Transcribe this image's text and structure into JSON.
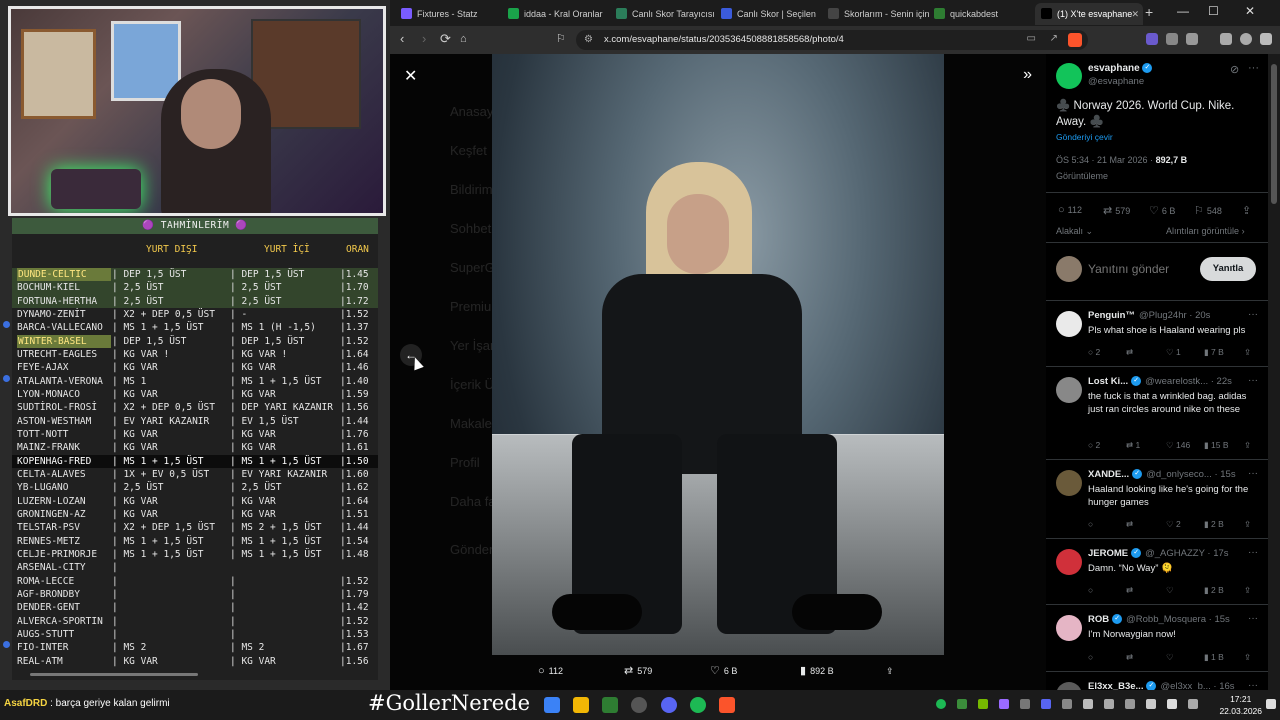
{
  "overlay": {
    "table_title": "TAHMİNLERİM",
    "headers": {
      "foreign": "YURT DIŞI",
      "domestic": "YURT İÇİ",
      "odds": "ORAN"
    },
    "rows": [
      {
        "match": "DUNDE-CELTIC",
        "foreign": "| DEP 1,5 ÜST",
        "domestic": "| DEP 1,5 ÜST",
        "odds": "|1.45",
        "style": "hl-green",
        "label_box": true,
        "dot": false
      },
      {
        "match": "BOCHUM-KIEL",
        "foreign": "| 2,5 ÜST",
        "domestic": "| 2,5 ÜST",
        "odds": "|1.70",
        "style": "hl-green",
        "label_box": false,
        "dot": false
      },
      {
        "match": "FORTUNA-HERTHA",
        "foreign": "| 2,5 ÜST",
        "domestic": "| 2,5 ÜST",
        "odds": "|1.72",
        "style": "hl-green",
        "label_box": false,
        "dot": false
      },
      {
        "match": "DYNAMO-ZENİT",
        "foreign": "| X2 + DEP 0,5 ÜST",
        "domestic": "| -",
        "odds": "|1.52",
        "style": "",
        "label_box": false,
        "dot": false
      },
      {
        "match": "BARCA-VALLECANO",
        "foreign": "| MS 1 + 1,5 ÜST",
        "domestic": "| MS 1 (H -1,5)",
        "odds": "|1.37",
        "style": "",
        "label_box": false,
        "dot": true
      },
      {
        "match": "WINTER-BASEL",
        "foreign": "| DEP 1,5 ÜST",
        "domestic": "| DEP 1,5 ÜST",
        "odds": "|1.52",
        "style": "",
        "label_box": true,
        "dot": false
      },
      {
        "match": "UTRECHT-EAGLES",
        "foreign": "| KG VAR !",
        "domestic": "| KG VAR !",
        "odds": "|1.64",
        "style": "",
        "label_box": false,
        "dot": false
      },
      {
        "match": "FEYE-AJAX",
        "foreign": "| KG VAR",
        "domestic": "| KG VAR",
        "odds": "|1.46",
        "style": "",
        "label_box": false,
        "dot": false
      },
      {
        "match": "ATALANTA-VERONA",
        "foreign": "| MS 1",
        "domestic": "| MS 1 + 1,5 ÜST",
        "odds": "|1.40",
        "style": "",
        "label_box": false,
        "dot": true
      },
      {
        "match": "LYON-MONACO",
        "foreign": "| KG VAR",
        "domestic": "| KG VAR",
        "odds": "|1.59",
        "style": "",
        "label_box": false,
        "dot": false
      },
      {
        "match": "SUDTİROL-FROSİ",
        "foreign": "| X2 + DEP 0,5 ÜST",
        "domestic": "| DEP YARI KAZANIR",
        "odds": "|1.56",
        "style": "",
        "label_box": false,
        "dot": false
      },
      {
        "match": "ASTON-WESTHAM",
        "foreign": "| EV YARI KAZANIR",
        "domestic": "| EV 1,5 ÜST",
        "odds": "|1.44",
        "style": "",
        "label_box": false,
        "dot": false
      },
      {
        "match": "TOTT-NOTT",
        "foreign": "| KG VAR",
        "domestic": "| KG VAR",
        "odds": "|1.76",
        "style": "",
        "label_box": false,
        "dot": false
      },
      {
        "match": "MAINZ-FRANK",
        "foreign": "| KG VAR",
        "domestic": "| KG VAR",
        "odds": "|1.61",
        "style": "",
        "label_box": false,
        "dot": false
      },
      {
        "match": "KOPENHAG-FRED",
        "foreign": "| MS 1 + 1,5 ÜST",
        "domestic": "| MS 1 + 1,5 ÜST",
        "odds": "|1.50",
        "style": "hl-sel",
        "label_box": false,
        "dot": false
      },
      {
        "match": "CELTA-ALAVES",
        "foreign": "| 1X + EV 0,5 ÜST",
        "domestic": "| EV YARI KAZANIR",
        "odds": "|1.60",
        "style": "",
        "label_box": false,
        "dot": false
      },
      {
        "match": "YB-LUGANO",
        "foreign": "| 2,5 ÜST",
        "domestic": "| 2,5 ÜST",
        "odds": "|1.62",
        "style": "",
        "label_box": false,
        "dot": false
      },
      {
        "match": "LUZERN-LOZAN",
        "foreign": "| KG VAR",
        "domestic": "| KG VAR",
        "odds": "|1.64",
        "style": "",
        "label_box": false,
        "dot": false
      },
      {
        "match": "GRONINGEN-AZ",
        "foreign": "| KG VAR",
        "domestic": "| KG VAR",
        "odds": "|1.51",
        "style": "",
        "label_box": false,
        "dot": false
      },
      {
        "match": "TELSTAR-PSV",
        "foreign": "| X2 + DEP 1,5 ÜST",
        "domestic": "| MS 2 + 1,5 ÜST",
        "odds": "|1.44",
        "style": "",
        "label_box": false,
        "dot": false
      },
      {
        "match": "RENNES-METZ",
        "foreign": "| MS 1 + 1,5 ÜST",
        "domestic": "| MS 1 + 1,5 ÜST",
        "odds": "|1.54",
        "style": "",
        "label_box": false,
        "dot": false
      },
      {
        "match": "CELJE-PRIMORJE",
        "foreign": "| MS 1 + 1,5 ÜST",
        "domestic": "| MS 1 + 1,5 ÜST",
        "odds": "|1.48",
        "style": "",
        "label_box": false,
        "dot": false
      },
      {
        "match": "ARSENAL-CITY",
        "foreign": "|",
        "domestic": "",
        "odds": "",
        "style": "",
        "label_box": false,
        "dot": false
      },
      {
        "match": "ROMA-LECCE",
        "foreign": "|",
        "domestic": "|",
        "odds": "|1.52",
        "style": "",
        "label_box": false,
        "dot": false
      },
      {
        "match": "AGF-BRONDBY",
        "foreign": "|",
        "domestic": "|",
        "odds": "|1.79",
        "style": "",
        "label_box": false,
        "dot": false
      },
      {
        "match": "DENDER-GENT",
        "foreign": "|",
        "domestic": "|",
        "odds": "|1.42",
        "style": "",
        "label_box": false,
        "dot": false
      },
      {
        "match": "ALVERCA-SPORTIN",
        "foreign": "|",
        "domestic": "|",
        "odds": "|1.52",
        "style": "",
        "label_box": false,
        "dot": false
      },
      {
        "match": "AUGS-STUTT",
        "foreign": "|",
        "domestic": "|",
        "odds": "|1.53",
        "style": "",
        "label_box": false,
        "dot": false
      },
      {
        "match": "FIO-INTER",
        "foreign": "| MS 2",
        "domestic": "| MS 2",
        "odds": "|1.67",
        "style": "",
        "label_box": false,
        "dot": true
      },
      {
        "match": "REAL-ATM",
        "foreign": "| KG VAR",
        "domestic": "| KG VAR",
        "odds": "|1.56",
        "style": "",
        "label_box": false,
        "dot": false
      }
    ]
  },
  "browser": {
    "tabs": [
      {
        "label": "Fixtures - Statz",
        "icon_color": "#7a5cff"
      },
      {
        "label": "iddaa - Kral Oranlar",
        "icon_color": "#1aa34a"
      },
      {
        "label": "Canlı Skor Tarayıcısı",
        "icon_color": "#2b7d5a"
      },
      {
        "label": "Canlı Skor | Seçilen",
        "icon_color": "#3b5bdb"
      },
      {
        "label": "Skorlarım - Senin için",
        "icon_color": "#444444"
      },
      {
        "label": "quickabdest",
        "icon_color": "#2e7d32"
      },
      {
        "label": "(1) X'te esvaphane",
        "icon_color": "#000000"
      }
    ],
    "url": "x.com/esvaphane/status/2035364508881858568/photo/4"
  },
  "viewer": {
    "ghost_menu": [
      "Anasayfa",
      "Keşfet",
      "Bildirimler",
      "Sohbet",
      "SuperGrok",
      "Premium",
      "Yer İşaretleri",
      "İçerik Üreticisi",
      "Makaleler",
      "Profil",
      "Daha fazla"
    ],
    "ghost_post_button": "Gönderi yayınla",
    "actions": {
      "replies": "112",
      "reposts": "579",
      "likes": "6 B",
      "views": "892 B"
    }
  },
  "tweet": {
    "name": "esvaphane",
    "handle": "@esvaphane",
    "text": "♣️ Norway 2026. World Cup. Nike. Away. ♣️",
    "translate": "Gönderiyi çevir",
    "time": "ÖS 5:34 · 21 Mar 2026 · ",
    "views_count": "892,7 B",
    "views_label": "Görüntüleme",
    "stats": {
      "replies": "112",
      "reposts": "579",
      "likes": "6 B",
      "bookmarks": "548"
    },
    "sort_label": "Alakalı",
    "quotes_label": "Alıntıları görüntüle",
    "reply_placeholder": "Yanıtını gönder",
    "reply_button": "Yanıtla"
  },
  "replies": [
    {
      "name": "Penguin™",
      "handle": "@Plug24hr · 20s",
      "verified": false,
      "text": "Pls what shoe is Haaland wearing pls",
      "stats": [
        "2",
        "",
        "1",
        "7 B"
      ],
      "av_color": "#eaeaea"
    },
    {
      "name": "Lost Ki...",
      "handle": "@wearelostk... · 22s",
      "verified": true,
      "text": "the fuck is that a wrinkled bag. adidas just ran circles around nike on these",
      "stats": [
        "2",
        "1",
        "146",
        "15 B"
      ],
      "av_color": "#888888"
    },
    {
      "name": "XANDE...",
      "handle": "@d_onlyseco... · 15s",
      "verified": true,
      "text": "Haaland looking like he's going for the hunger games",
      "stats": [
        "",
        "",
        "2",
        "2 B"
      ],
      "av_color": "#6a5a3a"
    },
    {
      "name": "JEROME",
      "handle": "@_AGHAZZY · 17s",
      "verified": true,
      "text": "Damn. “No Way” 🫠",
      "stats": [
        "",
        "",
        "",
        "2 B"
      ],
      "av_color": "#d0303a"
    },
    {
      "name": "ROB",
      "handle": "@Robb_Mosquera · 15s",
      "verified": true,
      "text": "I'm Norwaygian now!",
      "stats": [
        "",
        "",
        "",
        "1 B"
      ],
      "av_color": "#e5b5c5"
    },
    {
      "name": "El3xx_B3e...",
      "handle": "@el3xx_b... · 16s",
      "verified": true,
      "text": "",
      "stats": [
        "",
        "",
        "",
        ""
      ],
      "av_color": "#5a5a5a"
    }
  ],
  "taskbar": {
    "chat_user": "AsafDRD",
    "chat_text": " : barça geriye kalan gelirmi",
    "hashtag": "#GollerNerede",
    "time": "17:21",
    "date": "22.03.2026"
  }
}
